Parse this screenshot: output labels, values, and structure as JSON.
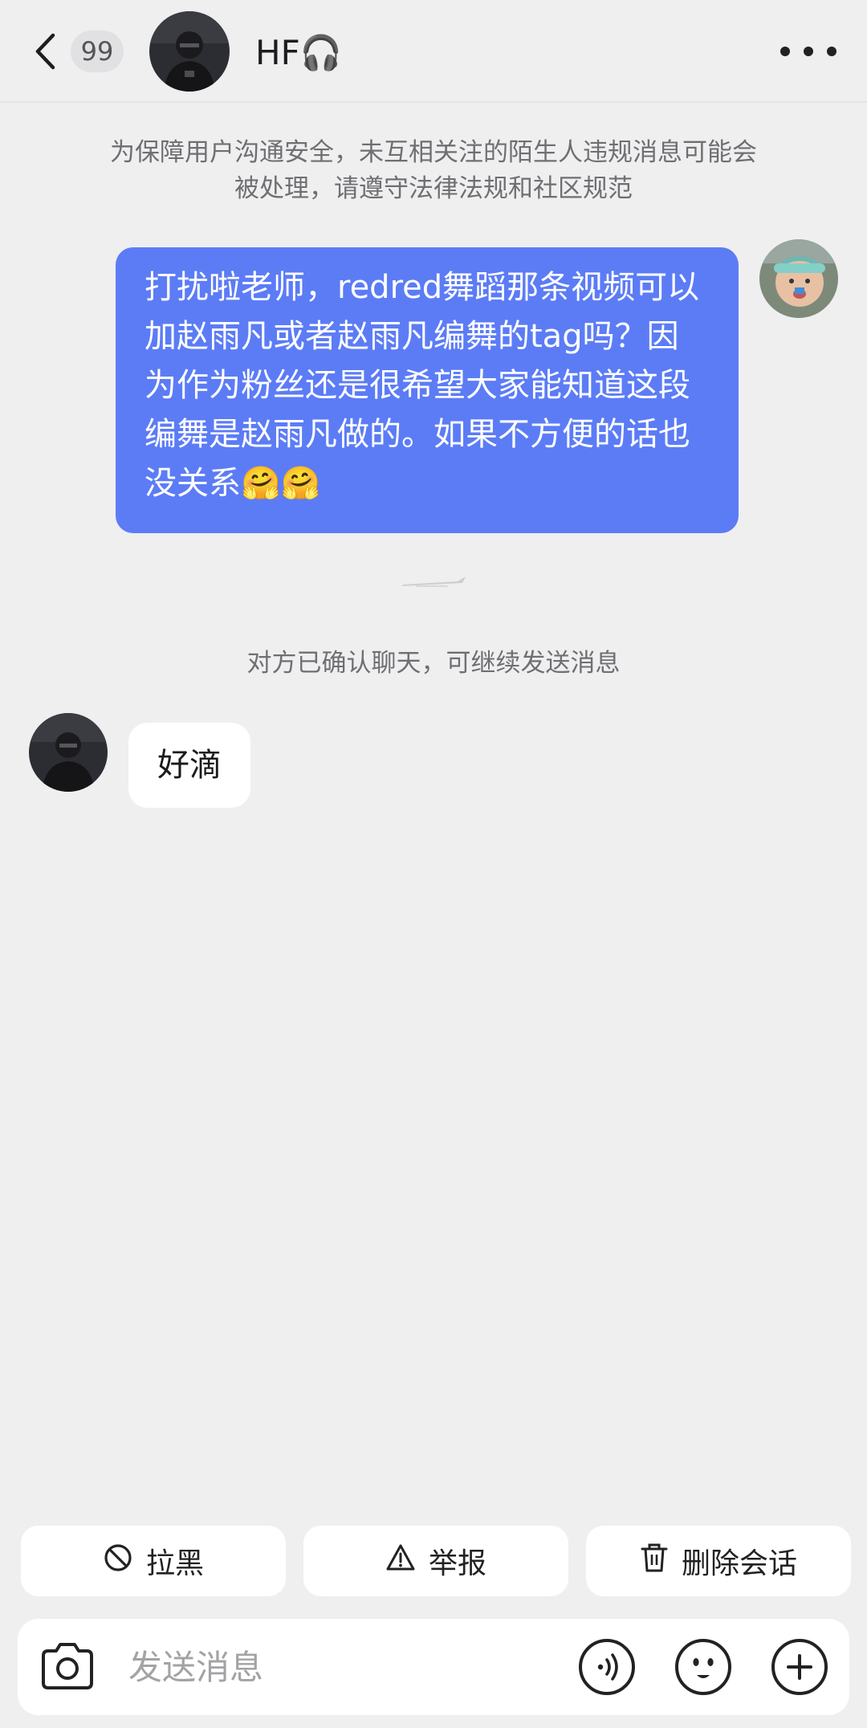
{
  "header": {
    "unread_count": "99",
    "contact_name": "HF🎧"
  },
  "notices": {
    "safety": "为保障用户沟通安全，未互相关注的陌生人违规消息可能会被处理，请遵守法律法规和社区规范",
    "confirmed": "对方已确认聊天，可继续发送消息"
  },
  "messages": [
    {
      "from": "self",
      "text": "打扰啦老师，redred舞蹈那条视频可以加赵雨凡或者赵雨凡编舞的tag吗？因为作为粉丝还是很希望大家能知道这段编舞是赵雨凡做的。如果不方便的话也没关系🤗🤗"
    },
    {
      "from": "peer",
      "text": "好滴"
    }
  ],
  "actions": {
    "block": "拉黑",
    "report": "举报",
    "delete": "删除会话"
  },
  "input": {
    "placeholder": "发送消息"
  },
  "colors": {
    "outgoing_bubble": "#5c7cf6",
    "incoming_bubble": "#ffffff",
    "background": "#efeff0"
  }
}
